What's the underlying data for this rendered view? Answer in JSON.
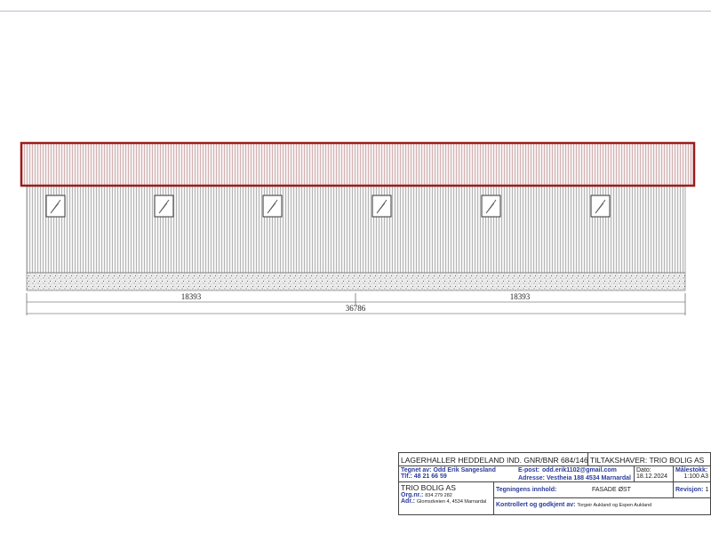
{
  "drawing": {
    "dimensions": {
      "left_segment": "18393",
      "right_segment": "18393",
      "total": "36786"
    },
    "window_count": 6,
    "roof_color": "#9b1c1c"
  },
  "title_block": {
    "project": "LAGERHALLER HEDDELAND IND. GNR/BNR 684/146",
    "owner": "TILTAKSHAVER: TRIO BOLIG AS",
    "drawn_by_label": "Tegnet av:",
    "drawn_by": "Odd Erik Sangesland",
    "phone_label": "Tlf.:",
    "phone": "48 21 66 59",
    "email_label": "E-post:",
    "email": "odd.erik1102@gmail.com",
    "address_label": "Adresse:",
    "address": "Vestheia 188 4534 Marnardal",
    "date_label": "Dato:",
    "date": "18.12.2024",
    "scale_label": "Målestokk:",
    "scale": "1:100 A3",
    "company": "TRIO BOLIG AS",
    "org_label": "Org.nr.:",
    "org": "834 279 282",
    "adr_label": "Adr.:",
    "adr": "Glomsdveien 4, 4534 Marnardal",
    "content_label": "Tegningens innhold:",
    "content": "FASADE ØST",
    "revision_label": "Revisjon:",
    "revision": "1",
    "approved_label": "Kontrollert og godkjent av:",
    "approved": "Torgeir Aukland og Espen Aukland"
  }
}
